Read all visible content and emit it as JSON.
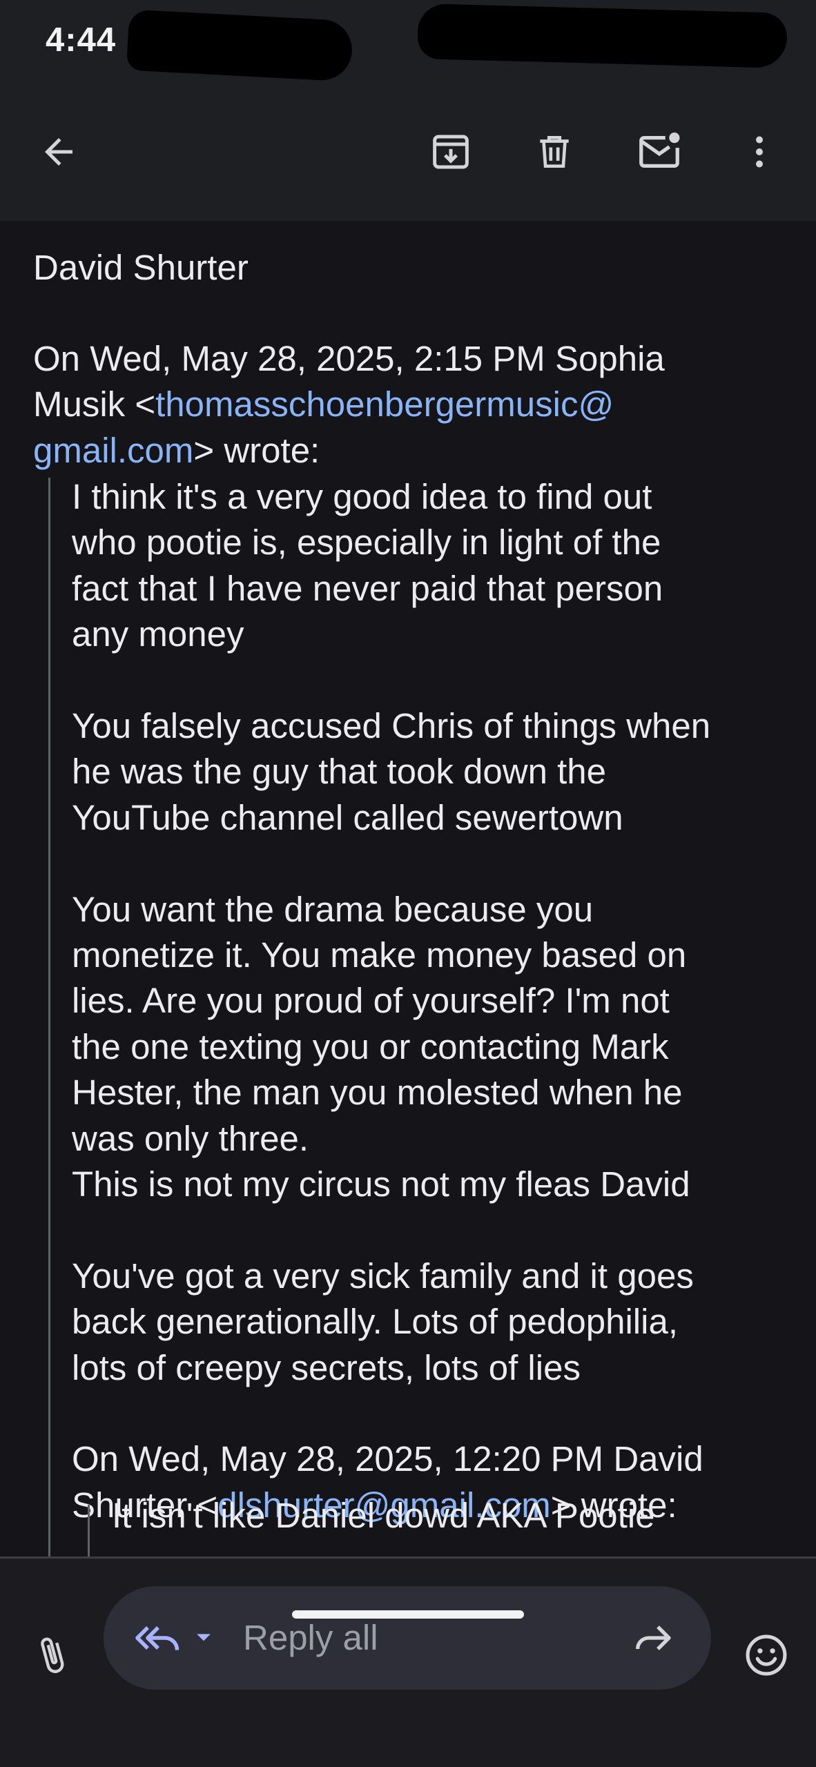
{
  "status_bar": {
    "time": "4:44"
  },
  "toolbar": {
    "back_icon": "arrow-back-icon",
    "archive_icon": "archive-icon",
    "delete_icon": "delete-icon",
    "mark_unread_icon": "mark-unread-icon",
    "more_icon": "more-vert-icon"
  },
  "message": {
    "sender_name": "David Shurter",
    "quote_header": {
      "line1": "On Wed, May 28, 2025, 2:15 PM Sophia",
      "line2_prefix": "Musik <",
      "email_part1": "thomasschoenbergermusic@",
      "email_part2": "gmail.com",
      "line3_suffix": "> wrote:"
    },
    "quoted_lines": [
      "I think it's a very good idea to find out",
      "who pootie is, especially in light of the",
      "fact that I have never paid that person",
      "any money",
      "",
      "You falsely accused Chris of things when",
      "he was the guy that took down the",
      "YouTube channel called sewertown",
      "",
      "You want the drama because you",
      "monetize it. You make money based on",
      "lies. Are you proud of yourself? I'm not",
      "the one texting you or contacting Mark",
      "Hester, the man you molested when he",
      "was only three.",
      "This is not my circus not my fleas David",
      "",
      "You've got a very sick family and it goes",
      "back generationally. Lots of pedophilia,",
      "lots of creepy secrets, lots of lies",
      ""
    ],
    "nested_header": {
      "line1": "On Wed, May 28, 2025, 12:20 PM David",
      "line2_prefix": "Shurter <",
      "email": "dlshurter@gmail.com",
      "line2_suffix": "> wrote:"
    },
    "nested_first_line": "It isn't like Daniel dowd AKA Pootie"
  },
  "reply_bar": {
    "attach_icon": "paperclip-icon",
    "reply_mode_icon": "reply-all-icon",
    "dropdown_icon": "chevron-down-icon",
    "placeholder": "Reply all",
    "forward_icon": "forward-icon",
    "emoji_icon": "emoji-icon"
  },
  "colors": {
    "background": "#141419",
    "toolbar": "#1e1f22",
    "link": "#8ab4f8",
    "reply_accent": "#a8b4ff"
  }
}
